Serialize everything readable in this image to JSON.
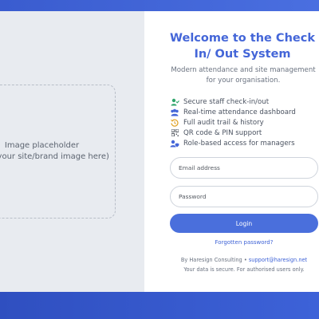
{
  "brand_panel": {
    "placeholder_line1": "Image placeholder",
    "placeholder_line2": "(load your site/brand image here)"
  },
  "login": {
    "title": "Welcome to the Check In/ Out System",
    "subtitle": "Modern attendance and site management for your organisation.",
    "features": [
      {
        "icon": "user-check-icon",
        "color": "#2fa56b",
        "label": "Secure staff check-in/out"
      },
      {
        "icon": "users-icon",
        "color": "#4466d8",
        "label": "Real-time attendance dashboard"
      },
      {
        "icon": "history-icon",
        "color": "#e0a020",
        "label": "Full audit trail & history"
      },
      {
        "icon": "qr-code-icon",
        "color": "#555a62",
        "label": "QR code & PIN support"
      },
      {
        "icon": "user-shield-icon",
        "color": "#4466d8",
        "label": "Role-based access for managers"
      }
    ],
    "email_placeholder": "Email address",
    "password_placeholder": "Password",
    "login_label": "Login",
    "forgot_label": "Forgotten password?",
    "footer_prefix": "By Haresign Consulting •",
    "footer_email": "support@haresign.net",
    "footer_note": "Your data is secure. For authorised users only."
  }
}
